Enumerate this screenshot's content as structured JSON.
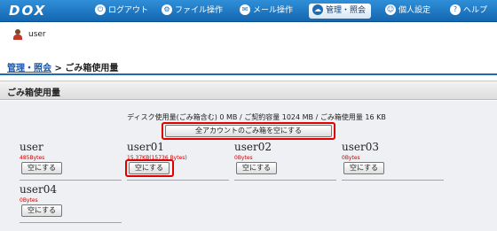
{
  "app": {
    "logo": "DOX"
  },
  "nav": [
    {
      "label": "ログアウト",
      "icon": "power-icon",
      "glyph": "⏻",
      "active": false
    },
    {
      "label": "ファイル操作",
      "icon": "folder-gear-icon",
      "glyph": "⚙",
      "active": false
    },
    {
      "label": "メール操作",
      "icon": "mail-icon",
      "glyph": "✉",
      "active": false
    },
    {
      "label": "管理・照会",
      "icon": "cloud-icon",
      "glyph": "☁",
      "active": true
    },
    {
      "label": "個人設定",
      "icon": "person-icon",
      "glyph": "☺",
      "active": false
    },
    {
      "label": "ヘルプ",
      "icon": "help-icon",
      "glyph": "?",
      "active": false
    }
  ],
  "user": {
    "name": "user"
  },
  "breadcrumb": {
    "parent": "管理・照会",
    "separator": ">",
    "current": "ごみ箱使用量"
  },
  "section": {
    "title": "ごみ箱使用量"
  },
  "usage": {
    "text": "ディスク使用量(ごみ箱含む) 0 MB / ご契約容量 1024 MB / ごみ箱使用量 16 KB"
  },
  "empty_all_button": "全アカウントのごみ箱を空にする",
  "accounts": [
    {
      "name": "user",
      "size": "485Bytes",
      "button": "空にする"
    },
    {
      "name": "user01",
      "size": "15.37KB(15736 Bytes)",
      "button": "空にする"
    },
    {
      "name": "user02",
      "size": "0Bytes",
      "button": "空にする"
    },
    {
      "name": "user03",
      "size": "0Bytes",
      "button": "空にする"
    },
    {
      "name": "user04",
      "size": "0Bytes",
      "button": "空にする"
    }
  ],
  "colors": {
    "nav_bar": "#1a6cb5",
    "highlight": "#e00000",
    "size_text": "#cc0000"
  }
}
